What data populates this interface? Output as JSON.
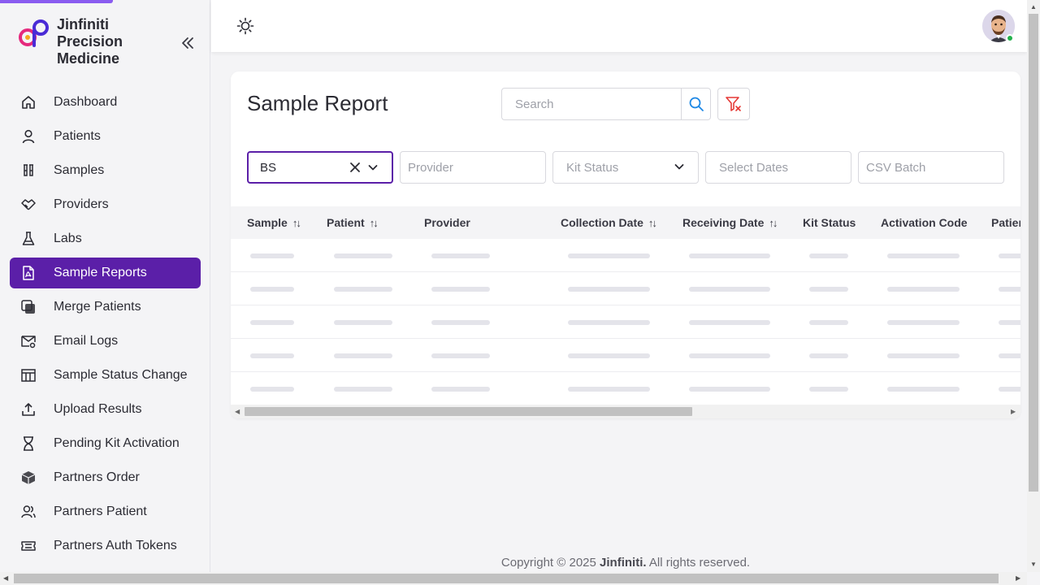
{
  "brand": {
    "name": "Jinfiniti Precision Medicine"
  },
  "sidebar": {
    "items": [
      {
        "label": "Dashboard",
        "icon": "home-icon",
        "active": false
      },
      {
        "label": "Patients",
        "icon": "user-icon",
        "active": false
      },
      {
        "label": "Samples",
        "icon": "test-tubes-icon",
        "active": false
      },
      {
        "label": "Providers",
        "icon": "handshake-icon",
        "active": false
      },
      {
        "label": "Labs",
        "icon": "flask-icon",
        "active": false
      },
      {
        "label": "Sample Reports",
        "icon": "pdf-file-icon",
        "active": true
      },
      {
        "label": "Merge Patients",
        "icon": "merge-icon",
        "active": false
      },
      {
        "label": "Email Logs",
        "icon": "mail-gear-icon",
        "active": false
      },
      {
        "label": "Sample Status Change",
        "icon": "table-icon",
        "active": false
      },
      {
        "label": "Upload Results",
        "icon": "upload-icon",
        "active": false
      },
      {
        "label": "Pending Kit Activation",
        "icon": "hourglass-icon",
        "active": false
      },
      {
        "label": "Partners Order",
        "icon": "box-icon",
        "active": false
      },
      {
        "label": "Partners Patient",
        "icon": "users-icon",
        "active": false
      },
      {
        "label": "Partners Auth Tokens",
        "icon": "ticket-icon",
        "active": false
      }
    ]
  },
  "header": {
    "status_color": "#22b14c"
  },
  "main": {
    "title": "Sample Report",
    "search": {
      "placeholder": "Search",
      "value": ""
    },
    "filters": {
      "sample_value": "BS",
      "provider_placeholder": "Provider",
      "kit_status_placeholder": "Kit Status",
      "dates_placeholder": "Select Dates",
      "csv_batch_placeholder": "CSV Batch"
    },
    "table": {
      "columns": [
        "Sample",
        "Patient",
        "Provider",
        "Collection Date",
        "Receiving Date",
        "Kit Status",
        "Activation Code",
        "Patien"
      ],
      "sortable": [
        true,
        true,
        false,
        true,
        true,
        false,
        false,
        false
      ],
      "loading_rows": 5
    }
  },
  "footer": {
    "prefix": "Copyright © 2025 ",
    "company": "Jinfiniti.",
    "suffix": " All rights reserved."
  },
  "colors": {
    "accent": "#5b1fa8",
    "accent_light": "#8a5cf0",
    "danger": "#e53935",
    "search_icon": "#1e88e5"
  }
}
